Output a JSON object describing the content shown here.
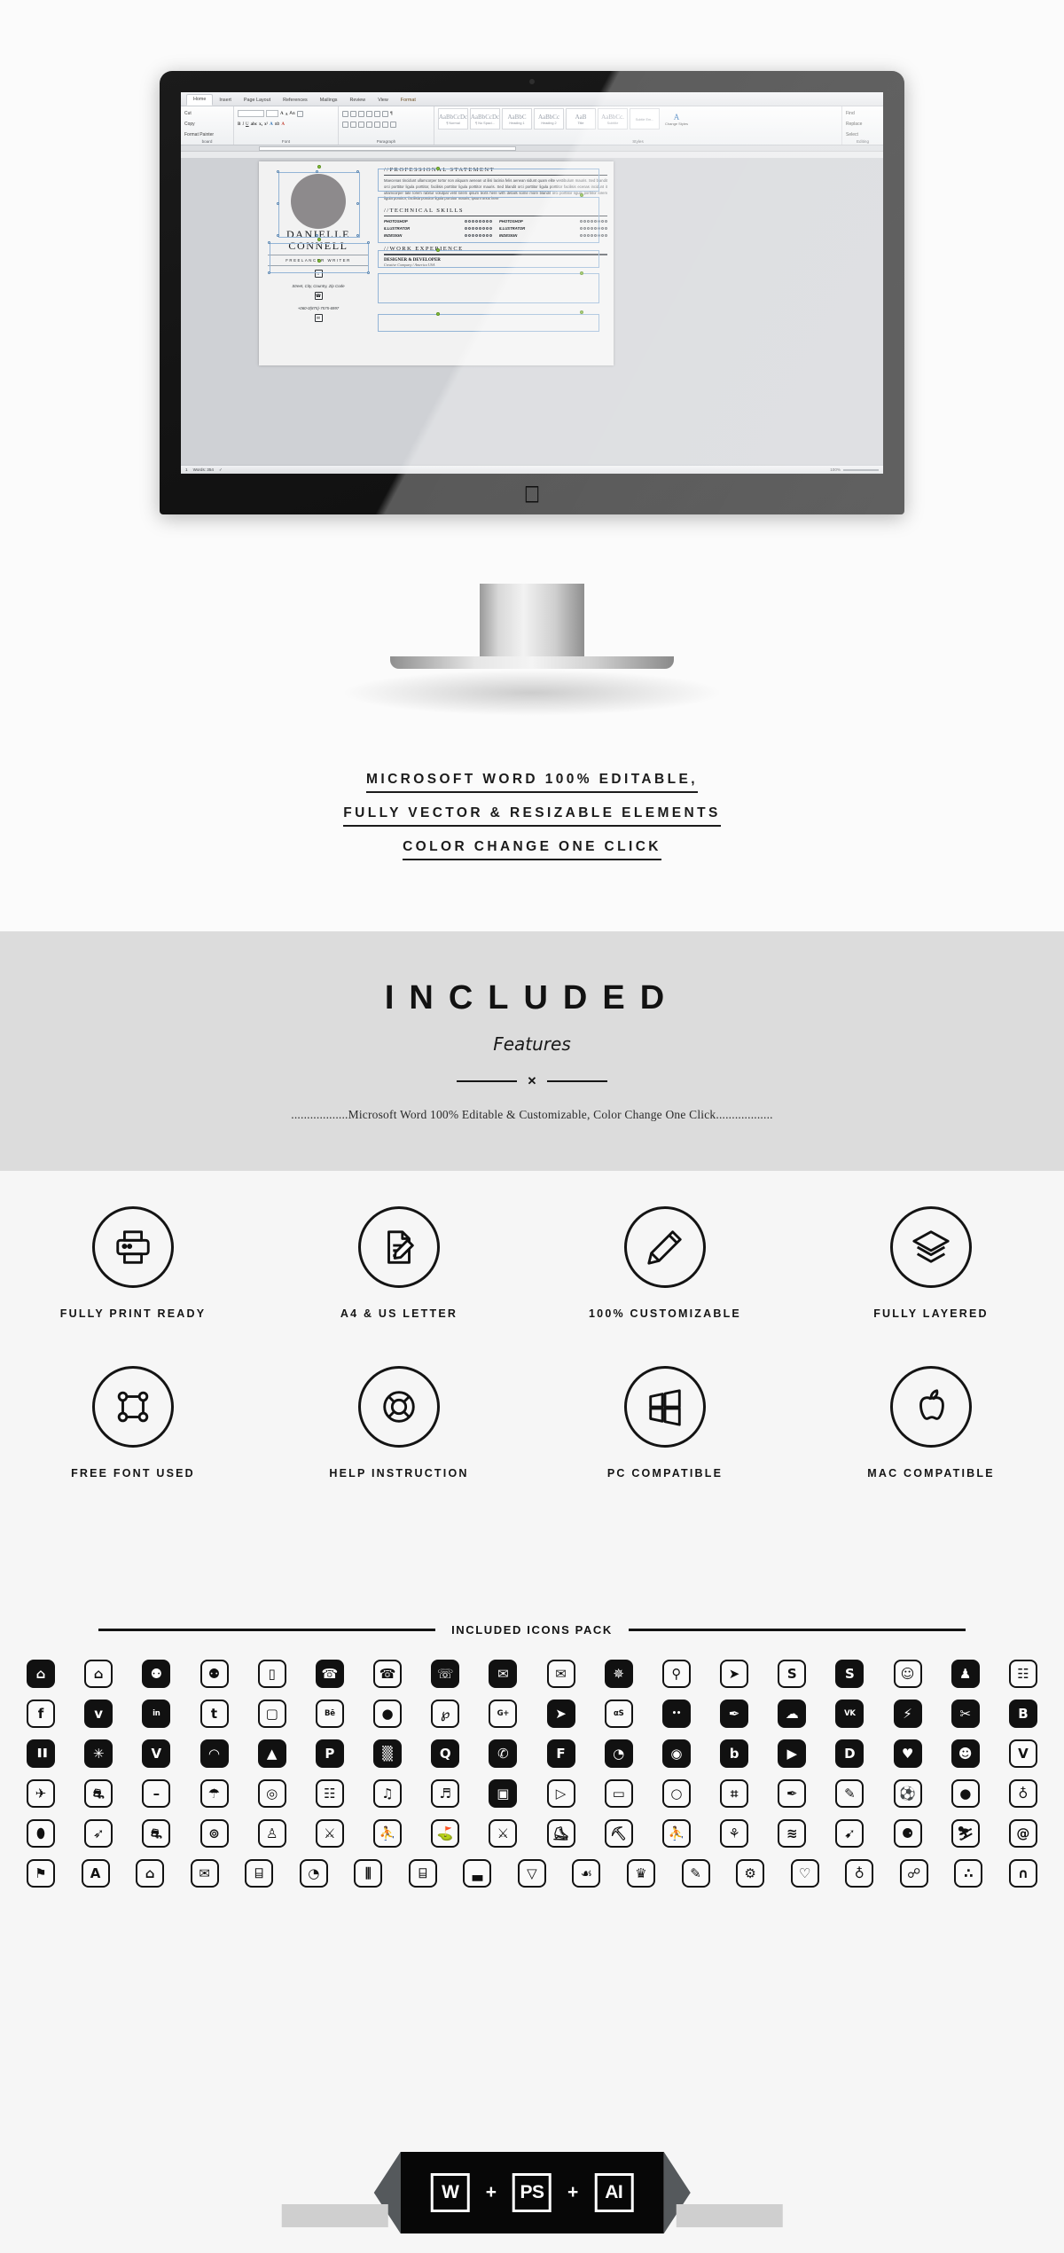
{
  "hero": {
    "word": {
      "tabs": [
        "Home",
        "Insert",
        "Page Layout",
        "References",
        "Mailings",
        "Review",
        "View",
        "Format"
      ],
      "clipboard": {
        "cut": "Cut",
        "copy": "Copy",
        "format_painter": "Format Painter",
        "group": "board"
      },
      "font_group": "Font",
      "paragraph_group": "Paragraph",
      "styles_group": "Styles",
      "editing_group": "Editing",
      "styles": [
        {
          "preview": "AaBbCcDc",
          "name": "¶ Normal"
        },
        {
          "preview": "AaBbCcDc",
          "name": "¶ No Spaci..."
        },
        {
          "preview": "AaBbC",
          "name": "Heading 1"
        },
        {
          "preview": "AaBbCc",
          "name": "Heading 2"
        },
        {
          "preview": "AaB",
          "name": "Title"
        },
        {
          "preview": "AaBbCc.",
          "name": "Subtitle"
        },
        {
          "preview": "",
          "name": "Subtle Em..."
        }
      ],
      "change_styles": "Change Styles",
      "editing": [
        "Find",
        "Replace",
        "Select"
      ],
      "status": {
        "page": "1",
        "words": "Words: 354",
        "zoom": "100%"
      }
    },
    "resume": {
      "first_name": "DANIELLE",
      "last_name": "CONNELL",
      "role": "FREELANCER WRITER",
      "address": "Street, City, Country, Zip Code",
      "phone": "+060-0(875)-7575-6997",
      "sections": {
        "statement_title": "//PROFESSIONAL STATEMENT",
        "statement_body": "Maecenas tincidunt ullamcorper tortor non aliquam aenean ut ilisi lacinia felis aenean sidunt quam elite vestibulum mauris. Sed blandit orci porttitor ligula porttitor, facilisis porttitor ligula porttitor mauris. Sed blandit orci porttitor ligula porttitor facilisis ecenas incidunt it ullamcorper tate lorem rabitur volutpat velit lorem ipsum texts here with details some more blandit orci porttitor ligula porttitor lorem ligula porttitor, facilisia porttitor ligula porttitor mauris, ipsum texts here",
        "skills_title": "//TECHNICAL SKILLS",
        "skills": [
          "PHOTOSHOP",
          "ILLUSTRATOR",
          "INDESIGN"
        ],
        "experience_title": "//WORK EXPERIENCE",
        "job_title": "DESIGNER & DEVELOPER",
        "job_sub": "Creative Company / America USA"
      }
    }
  },
  "tagline": {
    "lines": [
      "MICROSOFT WORD 100% EDITABLE,",
      "FULLY VECTOR & RESIZABLE ELEMENTS",
      "COLOR CHANGE ONE CLICK"
    ]
  },
  "band": {
    "title": "INCLUDED",
    "subtitle": "Features",
    "divider_mark": "✕",
    "note": "..................Microsoft Word 100% Editable & Customizable, Color Change One Click.................."
  },
  "features": [
    {
      "label": "FULLY PRINT READY",
      "icon": "printer-icon"
    },
    {
      "label": "A4 & US LETTER",
      "icon": "document-pencil-icon"
    },
    {
      "label": "100% CUSTOMIZABLE",
      "icon": "pencil-icon"
    },
    {
      "label": "FULLY LAYERED",
      "icon": "layers-icon"
    },
    {
      "label": "FREE FONT USED",
      "icon": "anchor-points-icon"
    },
    {
      "label": "HELP INSTRUCTION",
      "icon": "lifebuoy-icon"
    },
    {
      "label": "PC COMPATIBLE",
      "icon": "windows-icon"
    },
    {
      "label": "MAC COMPATIBLE",
      "icon": "apple-icon"
    }
  ],
  "icon_pack": {
    "title": "INCLUDED ICONS PACK",
    "rows": [
      [
        {
          "name": "home-solid-icon",
          "glyph": "⌂",
          "solid": true
        },
        {
          "name": "home-outline-icon",
          "glyph": "⌂"
        },
        {
          "name": "map-pin-solid-icon",
          "glyph": "⚉",
          "solid": true
        },
        {
          "name": "map-pin-outline-icon",
          "glyph": "⚉"
        },
        {
          "name": "mobile-phone-icon",
          "glyph": "▯"
        },
        {
          "name": "phone-solid-icon",
          "glyph": "☎",
          "solid": true
        },
        {
          "name": "phone-outline-icon",
          "glyph": "☎"
        },
        {
          "name": "telephone-icon",
          "glyph": "☏",
          "solid": true
        },
        {
          "name": "envelope-solid-icon",
          "glyph": "✉",
          "solid": true
        },
        {
          "name": "envelope-outline-icon",
          "glyph": "✉"
        },
        {
          "name": "loading-dots-icon",
          "glyph": "✵",
          "solid": true
        },
        {
          "name": "search-icon",
          "glyph": "⚲"
        },
        {
          "name": "paper-plane-icon",
          "glyph": "➤"
        },
        {
          "name": "skype-outline-icon",
          "glyph": "S"
        },
        {
          "name": "skype-solid-icon",
          "glyph": "S",
          "solid": true
        },
        {
          "name": "user-outline-icon",
          "glyph": "☺"
        },
        {
          "name": "user-solid-icon",
          "glyph": "♟",
          "solid": true
        },
        {
          "name": "contact-book-icon",
          "glyph": "☷"
        }
      ],
      [
        {
          "name": "facebook-icon",
          "glyph": "f"
        },
        {
          "name": "twitter-icon",
          "glyph": "ᴠ",
          "solid": true
        },
        {
          "name": "linkedin-icon",
          "glyph": "in",
          "solid": true
        },
        {
          "name": "tumblr-icon",
          "glyph": "t"
        },
        {
          "name": "instagram-icon",
          "glyph": "▢"
        },
        {
          "name": "behance-icon",
          "glyph": "Bē"
        },
        {
          "name": "dribbble-icon",
          "glyph": "●"
        },
        {
          "name": "pinterest-icon",
          "glyph": "℘"
        },
        {
          "name": "google-plus-icon",
          "glyph": "G+"
        },
        {
          "name": "telegram-icon",
          "glyph": "➤",
          "solid": true
        },
        {
          "name": "ameba-icon",
          "glyph": "αS"
        },
        {
          "name": "flickr-icon",
          "glyph": "••",
          "solid": true
        },
        {
          "name": "feather-icon",
          "glyph": "✒",
          "solid": true
        },
        {
          "name": "cloud-icon",
          "glyph": "☁",
          "solid": true
        },
        {
          "name": "vk-icon",
          "glyph": "VK",
          "solid": true
        },
        {
          "name": "flash-icon",
          "glyph": "⚡",
          "solid": true
        },
        {
          "name": "scissors-icon",
          "glyph": "✂",
          "solid": true
        },
        {
          "name": "blogger-icon",
          "glyph": "B",
          "solid": true
        }
      ],
      [
        {
          "name": "barcode-icon",
          "glyph": "▐▐",
          "solid": true
        },
        {
          "name": "asterisk-icon",
          "glyph": "✳",
          "solid": true
        },
        {
          "name": "vimeo-icon",
          "glyph": "V",
          "solid": true
        },
        {
          "name": "rss-icon",
          "glyph": "◠",
          "solid": true
        },
        {
          "name": "andrea-icon",
          "glyph": "▲",
          "solid": true
        },
        {
          "name": "parking-icon",
          "glyph": "P",
          "solid": true
        },
        {
          "name": "grid-icon",
          "glyph": "▒",
          "solid": true
        },
        {
          "name": "quora-icon",
          "glyph": "Q",
          "solid": true
        },
        {
          "name": "whatsapp-icon",
          "glyph": "✆",
          "solid": true
        },
        {
          "name": "foursquare-icon",
          "glyph": "F",
          "solid": true
        },
        {
          "name": "chat-bubble-icon",
          "glyph": "◔",
          "solid": true
        },
        {
          "name": "spotify-icon",
          "glyph": "◉",
          "solid": true
        },
        {
          "name": "bing-icon",
          "glyph": "b",
          "solid": true
        },
        {
          "name": "youtube-icon",
          "glyph": "▶",
          "solid": true
        },
        {
          "name": "dailymotion-icon",
          "glyph": "D",
          "solid": true
        },
        {
          "name": "twitch-icon",
          "glyph": "♥",
          "solid": true
        },
        {
          "name": "snapchat-icon",
          "glyph": "☻",
          "solid": true
        },
        {
          "name": "vine-icon",
          "glyph": "V"
        }
      ],
      [
        {
          "name": "airplane-icon",
          "glyph": "✈"
        },
        {
          "name": "car-icon",
          "glyph": "⛐"
        },
        {
          "name": "dumbbell-icon",
          "glyph": "–"
        },
        {
          "name": "umbrella-icon",
          "glyph": "☂"
        },
        {
          "name": "target-icon",
          "glyph": "◎"
        },
        {
          "name": "film-icon",
          "glyph": "☷"
        },
        {
          "name": "music-note-icon",
          "glyph": "♫"
        },
        {
          "name": "headphones-icon",
          "glyph": "♬"
        },
        {
          "name": "camera-icon",
          "glyph": "▣",
          "solid": true
        },
        {
          "name": "video-camera-icon",
          "glyph": "▷"
        },
        {
          "name": "tv-icon",
          "glyph": "▭"
        },
        {
          "name": "mouse-icon",
          "glyph": "○"
        },
        {
          "name": "gamepad-icon",
          "glyph": "⌗"
        },
        {
          "name": "eyedropper-icon",
          "glyph": "✒"
        },
        {
          "name": "pen-icon",
          "glyph": "✎"
        },
        {
          "name": "soccer-ball-icon",
          "glyph": "⚽"
        },
        {
          "name": "basketball-icon",
          "glyph": "●"
        },
        {
          "name": "medal-icon",
          "glyph": "♁"
        }
      ],
      [
        {
          "name": "football-icon",
          "glyph": "⬮"
        },
        {
          "name": "rocket-icon",
          "glyph": "➶"
        },
        {
          "name": "bicycle-icon",
          "glyph": "⛐"
        },
        {
          "name": "cycling-icon",
          "glyph": "⊚"
        },
        {
          "name": "bowling-icon",
          "glyph": "♙"
        },
        {
          "name": "karate-icon",
          "glyph": "⚔"
        },
        {
          "name": "running-icon",
          "glyph": "⛹"
        },
        {
          "name": "golf-icon",
          "glyph": "⛳"
        },
        {
          "name": "fencing-icon",
          "glyph": "⚔"
        },
        {
          "name": "ice-skate-icon",
          "glyph": "⛸"
        },
        {
          "name": "dumbbell2-icon",
          "glyph": "⛏"
        },
        {
          "name": "athlete-icon",
          "glyph": "⛹"
        },
        {
          "name": "gymnastics-icon",
          "glyph": "⚘"
        },
        {
          "name": "swimming-icon",
          "glyph": "≋"
        },
        {
          "name": "archery-icon",
          "glyph": "➹"
        },
        {
          "name": "billiards-icon",
          "glyph": "⚈"
        },
        {
          "name": "ski-icon",
          "glyph": "⛷"
        },
        {
          "name": "spiral-icon",
          "glyph": "@"
        }
      ],
      [
        {
          "name": "graduation-cap-icon",
          "glyph": "⚑"
        },
        {
          "name": "book-icon",
          "glyph": "A"
        },
        {
          "name": "bank-icon",
          "glyph": "⌂"
        },
        {
          "name": "mail-document-icon",
          "glyph": "✉"
        },
        {
          "name": "clipboard-icon",
          "glyph": "⌸"
        },
        {
          "name": "pie-chart-icon",
          "glyph": "◔"
        },
        {
          "name": "sliders-icon",
          "glyph": "⫼"
        },
        {
          "name": "chart-board-icon",
          "glyph": "⌸"
        },
        {
          "name": "bar-chart-icon",
          "glyph": "▃"
        },
        {
          "name": "funnel-icon",
          "glyph": "▽"
        },
        {
          "name": "award-icon",
          "glyph": "☙"
        },
        {
          "name": "trophy-icon",
          "glyph": "♛"
        },
        {
          "name": "pencil2-icon",
          "glyph": "✎"
        },
        {
          "name": "gear-icon",
          "glyph": "⚙"
        },
        {
          "name": "heart-icon",
          "glyph": "♡"
        },
        {
          "name": "globe-icon",
          "glyph": "♁"
        },
        {
          "name": "paperclip-icon",
          "glyph": "☍"
        },
        {
          "name": "share-icon",
          "glyph": "∴"
        },
        {
          "name": "magnet-icon",
          "glyph": "∩"
        }
      ]
    ]
  },
  "footer": {
    "badges": [
      "W",
      "PS",
      "AI"
    ],
    "separator": "+"
  }
}
